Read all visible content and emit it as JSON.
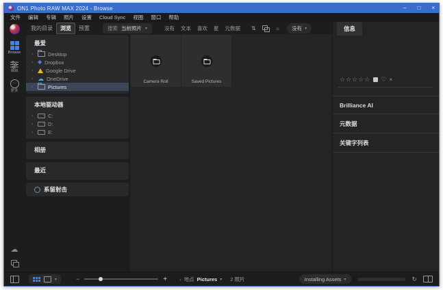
{
  "titlebar": {
    "app_title": "ON1 Photo RAW MAX 2024 - Browse",
    "minimize": "–",
    "maximize": "□",
    "close": "×"
  },
  "menubar": {
    "items": [
      "文件",
      "编辑",
      "专辑",
      "照片",
      "设置",
      "Cloud Sync",
      "视图",
      "窗口",
      "帮助"
    ]
  },
  "rail": {
    "modules": [
      {
        "label": "Browse"
      },
      {
        "label": "编辑"
      },
      {
        "label": "更多"
      }
    ],
    "more_glyph": "⋯",
    "cloud_glyph": "☁"
  },
  "tabs": {
    "my_catalogs": "我的目录",
    "browse": "浏览",
    "presets": "预置"
  },
  "toolbar": {
    "search_label": "搜索",
    "search_scope": "当前照片",
    "caret": "▾",
    "filters": [
      "没有",
      "文本",
      "喜欢",
      "星",
      "元数据"
    ],
    "sort_icon_glyph": "⇅",
    "light_icon_glyph": "☼",
    "sort_dropdown": "没有"
  },
  "sidebar": {
    "favorites": {
      "title": "最爱",
      "chevron": "›",
      "dropbox_glyph": "◆",
      "onedrive_glyph": "☁",
      "items": [
        {
          "label": "Desktop"
        },
        {
          "label": "Dropbox"
        },
        {
          "label": "Google Drive"
        },
        {
          "label": "OneDrive"
        },
        {
          "label": "Pictures"
        }
      ]
    },
    "local_drives": {
      "title": "本地驱动器",
      "items": [
        {
          "label": "C:"
        },
        {
          "label": "D:"
        },
        {
          "label": "E:"
        }
      ]
    },
    "albums": {
      "title": "相册"
    },
    "recent": {
      "title": "最近"
    },
    "tethered": {
      "title": "系留射击"
    }
  },
  "content": {
    "folders": [
      {
        "label": "Camera Roll"
      },
      {
        "label": "Saved Pictures"
      }
    ]
  },
  "info_panel": {
    "title": "信息",
    "stars": "☆☆☆☆☆",
    "heart": "♡",
    "clear": "×",
    "sections": [
      {
        "label": "Brilliance AI"
      },
      {
        "label": "元数据"
      },
      {
        "label": "关键字列表"
      }
    ]
  },
  "statusbar": {
    "back": "‹",
    "location_label": "地点",
    "folder": "Pictures",
    "caret": "▾",
    "count": "2 照片",
    "zoom_minus": "−",
    "zoom_plus": "+",
    "installing_label": "Installing Assets",
    "progress_percent": 100,
    "refresh_glyph": "↻"
  },
  "colors": {
    "titlebar_blue": "#3a6dcb",
    "accent_blue": "#3e74d4",
    "selection_row": "#3b4658"
  }
}
